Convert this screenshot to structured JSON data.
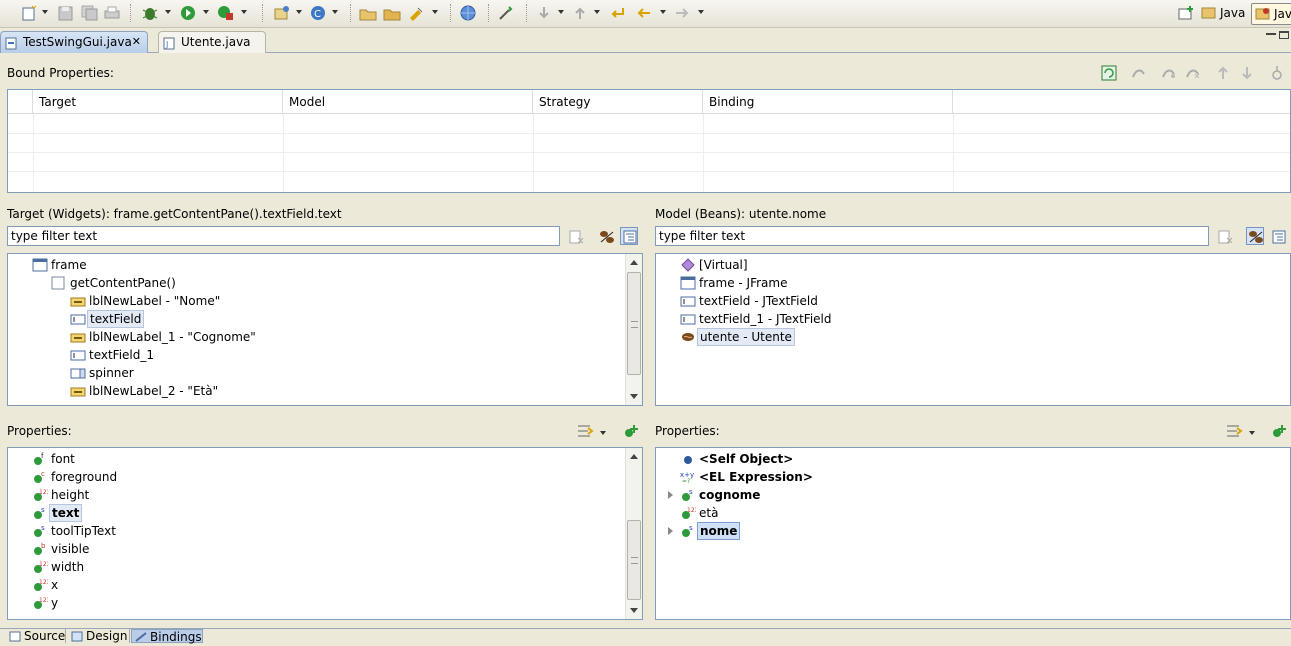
{
  "toolbar": {
    "perspectives": [
      "Java",
      "Java"
    ]
  },
  "editor_tabs": [
    {
      "label": "TestSwingGui.java"
    },
    {
      "label": "Utente.java"
    }
  ],
  "bound_properties": {
    "title": "Bound Properties:",
    "columns": [
      "Target",
      "Model",
      "Strategy",
      "Binding"
    ]
  },
  "target": {
    "title": "Target (Widgets): frame.getContentPane().textField.text",
    "filter_text": "type filter text",
    "tree": [
      {
        "label": "frame"
      },
      {
        "label": "getContentPane()"
      },
      {
        "label": "lblNewLabel - \"Nome\""
      },
      {
        "label": "textField"
      },
      {
        "label": "lblNewLabel_1 - \"Cognome\""
      },
      {
        "label": "textField_1"
      },
      {
        "label": "spinner"
      },
      {
        "label": "lblNewLabel_2 - \"Età\""
      }
    ],
    "properties_title": "Properties:",
    "properties": [
      {
        "label": "font"
      },
      {
        "label": "foreground"
      },
      {
        "label": "height"
      },
      {
        "label": "text"
      },
      {
        "label": "toolTipText"
      },
      {
        "label": "visible"
      },
      {
        "label": "width"
      },
      {
        "label": "x"
      },
      {
        "label": "y"
      }
    ]
  },
  "model": {
    "title": "Model (Beans): utente.nome",
    "filter_text": "type filter text",
    "tree": [
      {
        "label": "[Virtual]"
      },
      {
        "label": "frame - JFrame"
      },
      {
        "label": "textField - JTextField"
      },
      {
        "label": "textField_1 - JTextField"
      },
      {
        "label": "utente - Utente"
      }
    ],
    "properties_title": "Properties:",
    "properties": [
      {
        "label": "<Self Object>"
      },
      {
        "label": "<EL Expression>"
      },
      {
        "label": "cognome"
      },
      {
        "label": "età"
      },
      {
        "label": "nome"
      }
    ]
  },
  "bottom_tabs": [
    {
      "label": "Source"
    },
    {
      "label": "Design"
    },
    {
      "label": "Bindings"
    }
  ]
}
